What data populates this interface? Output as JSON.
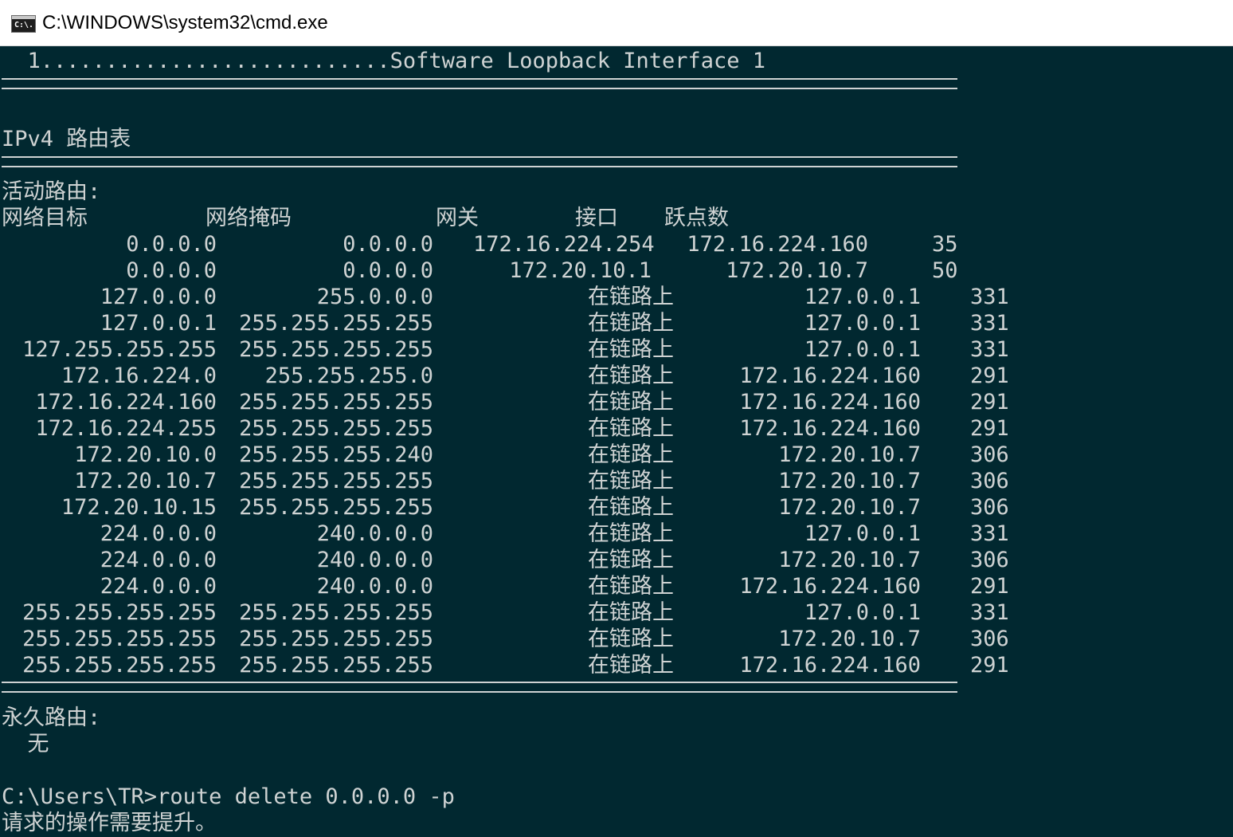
{
  "window": {
    "title": "C:\\WINDOWS\\system32\\cmd.exe",
    "icon": "cmd-icon",
    "icon_text": "C:\\."
  },
  "console": {
    "interface_line": "  1...........................Software Loopback Interface 1",
    "table_title": "IPv4 路由表",
    "active_routes_label": "活动路由:",
    "headers": {
      "dest": "网络目标",
      "mask": "网络掩码",
      "gateway": "网关",
      "interface": "接口",
      "metric": "跃点数"
    },
    "routes": [
      {
        "dest": "0.0.0.0",
        "mask": "0.0.0.0",
        "gateway": "172.16.224.254",
        "interface": "172.16.224.160",
        "metric": "35"
      },
      {
        "dest": "0.0.0.0",
        "mask": "0.0.0.0",
        "gateway": "172.20.10.1",
        "interface": "172.20.10.7",
        "metric": "50"
      },
      {
        "dest": "127.0.0.0",
        "mask": "255.0.0.0",
        "gateway": "在链路上",
        "interface": "127.0.0.1",
        "metric": "331"
      },
      {
        "dest": "127.0.0.1",
        "mask": "255.255.255.255",
        "gateway": "在链路上",
        "interface": "127.0.0.1",
        "metric": "331"
      },
      {
        "dest": "127.255.255.255",
        "mask": "255.255.255.255",
        "gateway": "在链路上",
        "interface": "127.0.0.1",
        "metric": "331"
      },
      {
        "dest": "172.16.224.0",
        "mask": "255.255.255.0",
        "gateway": "在链路上",
        "interface": "172.16.224.160",
        "metric": "291"
      },
      {
        "dest": "172.16.224.160",
        "mask": "255.255.255.255",
        "gateway": "在链路上",
        "interface": "172.16.224.160",
        "metric": "291"
      },
      {
        "dest": "172.16.224.255",
        "mask": "255.255.255.255",
        "gateway": "在链路上",
        "interface": "172.16.224.160",
        "metric": "291"
      },
      {
        "dest": "172.20.10.0",
        "mask": "255.255.255.240",
        "gateway": "在链路上",
        "interface": "172.20.10.7",
        "metric": "306"
      },
      {
        "dest": "172.20.10.7",
        "mask": "255.255.255.255",
        "gateway": "在链路上",
        "interface": "172.20.10.7",
        "metric": "306"
      },
      {
        "dest": "172.20.10.15",
        "mask": "255.255.255.255",
        "gateway": "在链路上",
        "interface": "172.20.10.7",
        "metric": "306"
      },
      {
        "dest": "224.0.0.0",
        "mask": "240.0.0.0",
        "gateway": "在链路上",
        "interface": "127.0.0.1",
        "metric": "331"
      },
      {
        "dest": "224.0.0.0",
        "mask": "240.0.0.0",
        "gateway": "在链路上",
        "interface": "172.20.10.7",
        "metric": "306"
      },
      {
        "dest": "224.0.0.0",
        "mask": "240.0.0.0",
        "gateway": "在链路上",
        "interface": "172.16.224.160",
        "metric": "291"
      },
      {
        "dest": "255.255.255.255",
        "mask": "255.255.255.255",
        "gateway": "在链路上",
        "interface": "127.0.0.1",
        "metric": "331"
      },
      {
        "dest": "255.255.255.255",
        "mask": "255.255.255.255",
        "gateway": "在链路上",
        "interface": "172.20.10.7",
        "metric": "306"
      },
      {
        "dest": "255.255.255.255",
        "mask": "255.255.255.255",
        "gateway": "在链路上",
        "interface": "172.16.224.160",
        "metric": "291"
      }
    ],
    "persistent_routes_label": "永久路由:",
    "persistent_routes_value": "  无",
    "prompt_line": "C:\\Users\\TR>route delete 0.0.0.0 -p",
    "error_line": "请求的操作需要提升。"
  },
  "colors": {
    "console_background": "#012830",
    "console_text": "#cfd3d3",
    "titlebar_background": "#ffffff"
  }
}
